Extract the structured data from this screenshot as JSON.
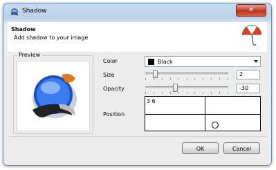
{
  "window": {
    "title": "Shadow",
    "close_label": "✕"
  },
  "header": {
    "title": "Shadow",
    "subtitle": "Add shadow to your image"
  },
  "preview": {
    "label": "Preview"
  },
  "color": {
    "label": "Color",
    "value": "Black",
    "swatch": "#000000"
  },
  "size": {
    "label": "Size",
    "value": "2",
    "slider_fraction": 0.1
  },
  "opacity": {
    "label": "Opacity",
    "value": "-30",
    "slider_fraction": 0.35
  },
  "position": {
    "label": "Position",
    "coords": "3 6"
  },
  "buttons": {
    "ok": "OK",
    "cancel": "Cancel"
  },
  "colors": {
    "title_bar": "#c9dcee",
    "close": "#c8462f",
    "dialog_bg": "#ececec"
  }
}
